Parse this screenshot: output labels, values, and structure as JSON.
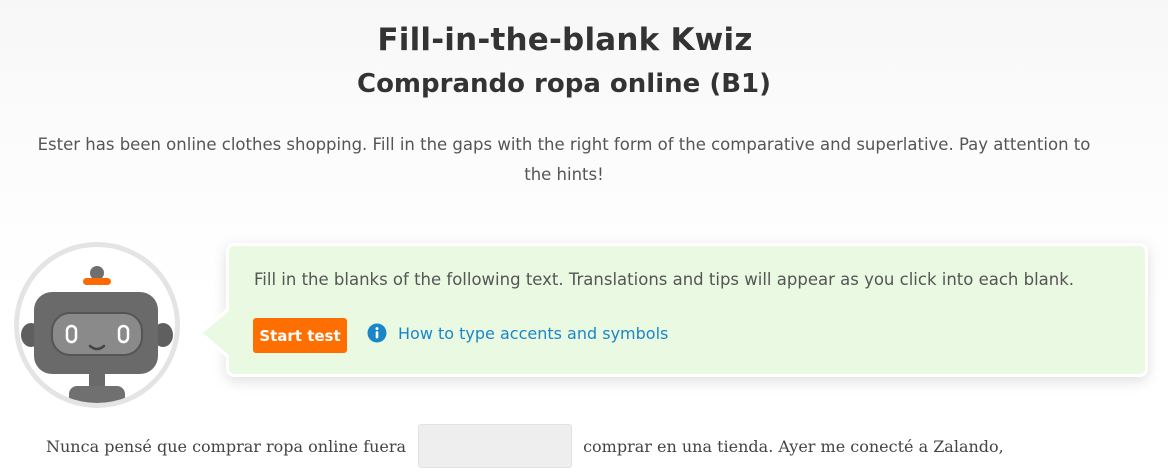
{
  "header": {
    "title": "Fill-in-the-blank Kwiz",
    "subtitle": "Comprando ropa online (B1)"
  },
  "intro": "Ester has been online clothes shopping. Fill in the gaps with the right form of the comparative and superlative. Pay attention to the hints!",
  "bubble": {
    "instruction": "Fill in the blanks of the following text. Translations and tips will appear as you click into each blank.",
    "start_button": "Start test",
    "accents_link": "How to type accents and symbols",
    "background_color": "#eaf9e1"
  },
  "avatar": {
    "icon": "robot-icon"
  },
  "exercise": {
    "before_blank": "Nunca pensé que comprar ropa online fuera",
    "blank_value": "",
    "after_blank": "comprar en una tienda.  Ayer me conecté a Zalando,"
  },
  "colors": {
    "accent": "#ff6f00",
    "link": "#1a86c8"
  }
}
